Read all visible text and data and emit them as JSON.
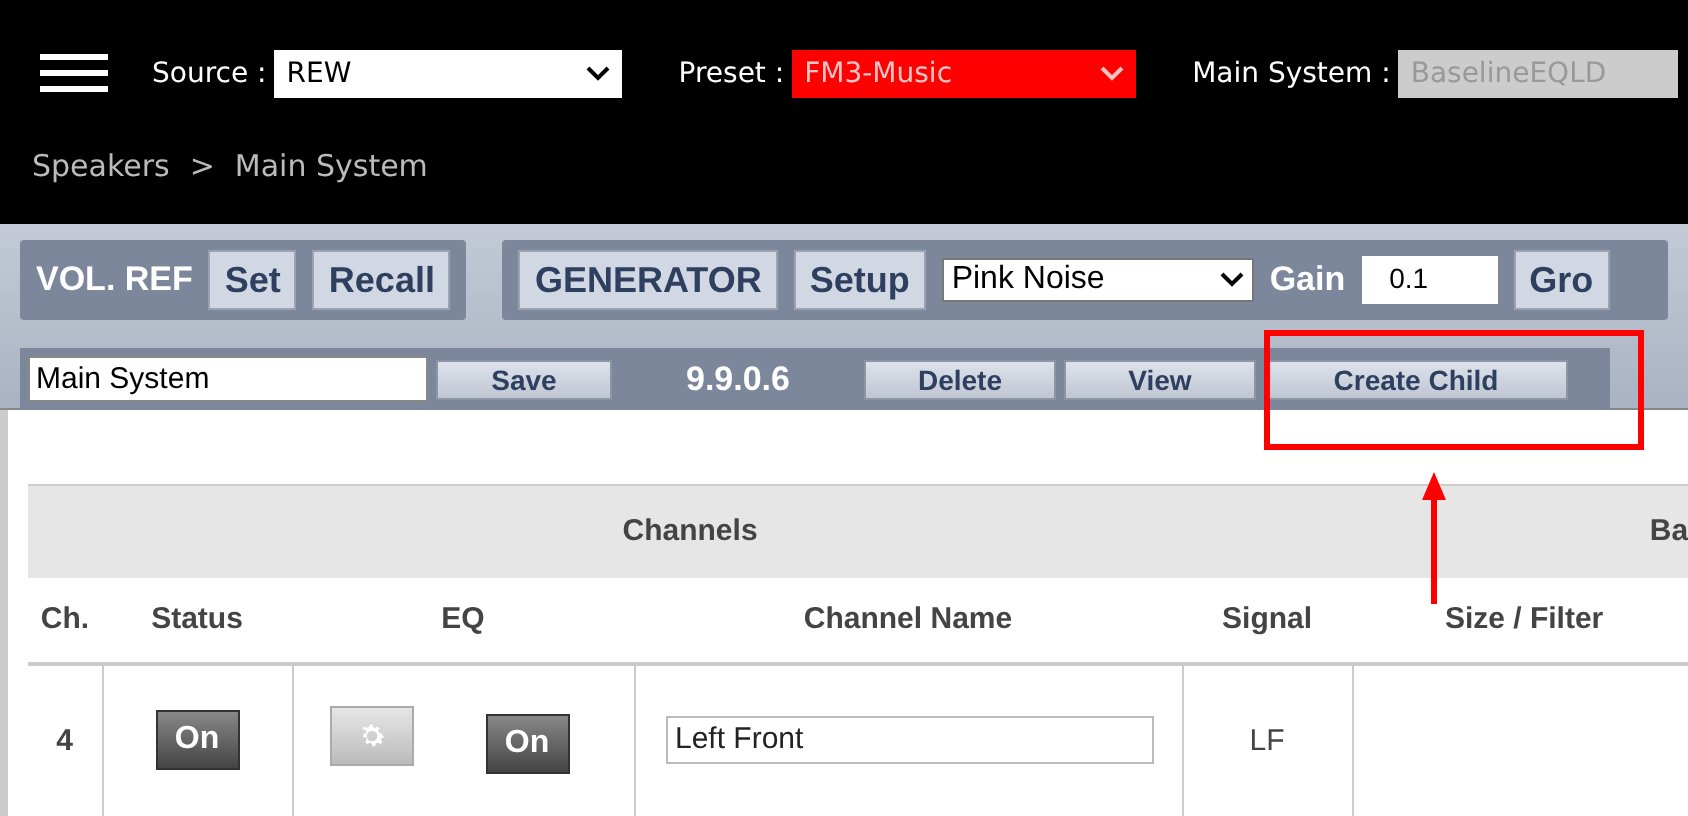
{
  "header": {
    "source": {
      "label": "Source :",
      "value": "REW"
    },
    "preset": {
      "label": "Preset :",
      "value": "FM3-Music"
    },
    "main_system": {
      "label": "Main System :",
      "value": "BaselineEQLD",
      "disabled": true
    }
  },
  "breadcrumb": [
    "Speakers",
    ">",
    "Main System"
  ],
  "toolbar": {
    "vol_ref": {
      "label": "VOL. REF",
      "buttons": [
        "Set",
        "Recall"
      ]
    },
    "generator": {
      "label": "GENERATOR",
      "setup": "Setup",
      "signal": "Pink Noise",
      "gain_label": "Gain",
      "gain": "0.1",
      "cut_button": "Gro"
    }
  },
  "system_bar": {
    "name": "Main System",
    "save": "Save",
    "version": "9.9.0.6",
    "delete": "Delete",
    "view": "View",
    "create_child": "Create Child"
  },
  "table": {
    "groups": [
      "Channels",
      "Ba"
    ],
    "columns": [
      "Ch.",
      "Status",
      "EQ",
      "Channel Name",
      "Signal",
      "Size / Filter"
    ],
    "rows": [
      {
        "ch": "4",
        "status": "On",
        "eq_settings": true,
        "eq": "On",
        "name": "Left Front",
        "signal": "LF"
      }
    ]
  }
}
